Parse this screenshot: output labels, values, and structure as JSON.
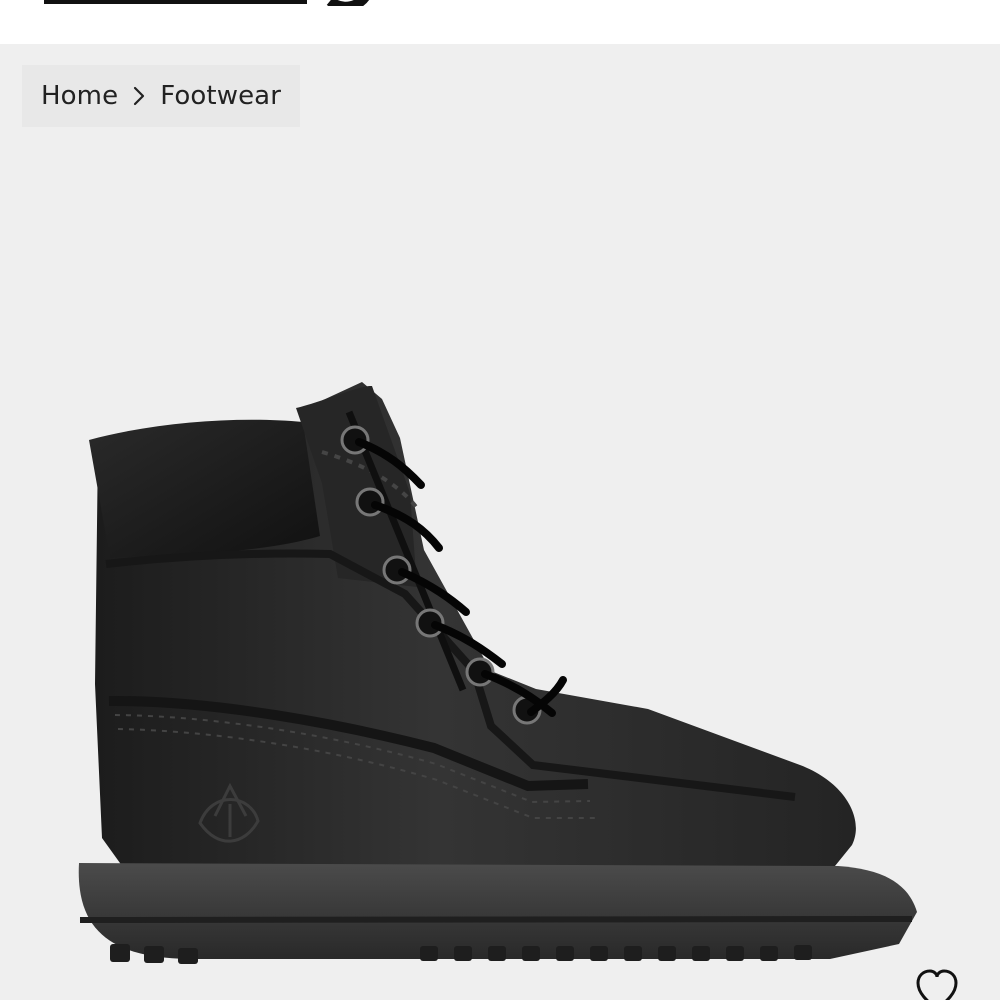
{
  "header": {
    "logo_icon": "timberland-logo"
  },
  "breadcrumb": {
    "items": [
      {
        "label": "Home"
      },
      {
        "label": "Footwear"
      }
    ],
    "separator_icon": "chevron-right-icon"
  },
  "product": {
    "image_icon": "black-boot-image"
  },
  "actions": {
    "wishlist_icon": "heart-outline-icon"
  },
  "colors": {
    "background": "#efefef",
    "breadcrumb_background": "#e8e8e8",
    "text": "#222222",
    "boot": "#2b2b2b"
  }
}
